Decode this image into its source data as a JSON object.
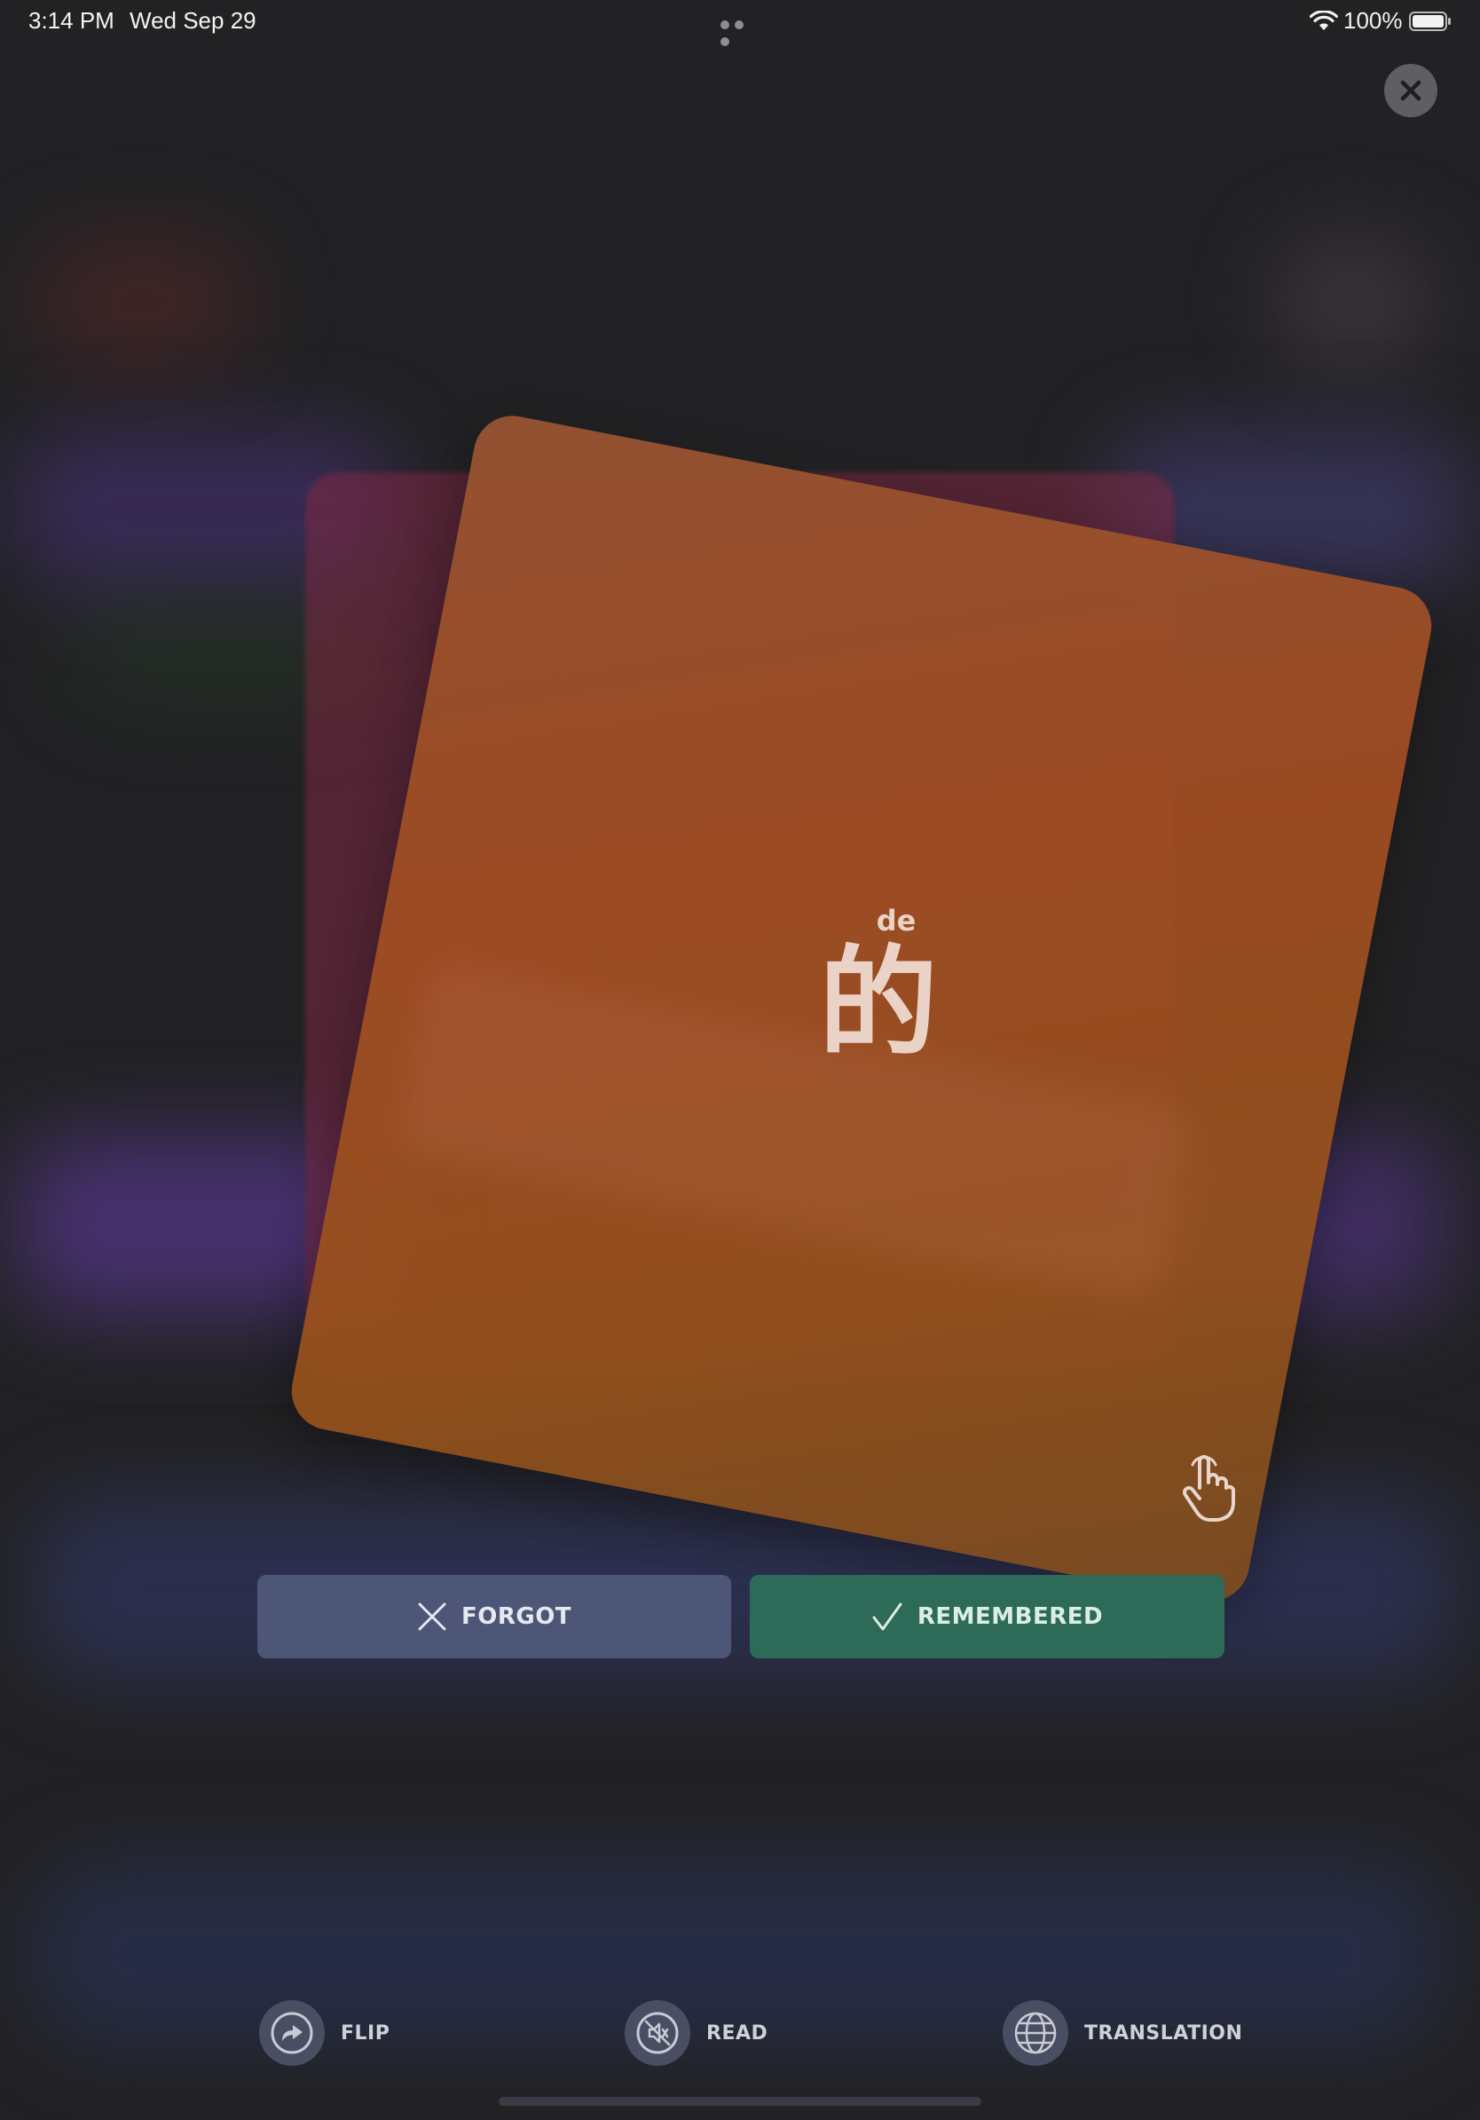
{
  "status_bar": {
    "time": "3:14 PM",
    "date": "Wed Sep 29",
    "battery": "100%"
  },
  "card": {
    "pinyin": "de",
    "character": "的",
    "color": "#a24e22"
  },
  "buttons": {
    "forgot_label": "FORGOT",
    "remembered_label": "REMEMBERED"
  },
  "actions": {
    "flip_label": "FLIP",
    "read_label": "READ",
    "translation_label": "TRANSLATION"
  },
  "icons": {
    "close": "close-icon",
    "hand": "tap-hand-icon",
    "flip": "flip-arrow-icon",
    "read": "speaker-muted-icon",
    "translation": "globe-icon"
  },
  "colors": {
    "forgot": "#4d5676",
    "remembered": "#2d6a58",
    "background": "#222224"
  }
}
